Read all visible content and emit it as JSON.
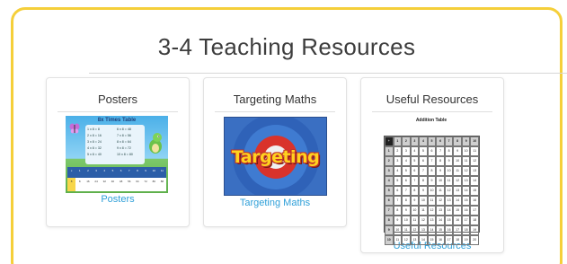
{
  "page": {
    "title": "3-4 Teaching Resources",
    "accent_color": "#f5cf3a",
    "link_color": "#2e9fd8"
  },
  "cards": [
    {
      "title": "Posters",
      "link": "Posters",
      "thumbnail_icon": "times-table-poster-icon"
    },
    {
      "title": "Targeting Maths",
      "link": "Targeting Maths",
      "thumbnail_icon": "targeting-logo-icon"
    },
    {
      "title": "Useful Resources",
      "link": "Useful Resources",
      "thumbnail_icon": "addition-table-icon"
    }
  ],
  "thumbnails": {
    "poster": {
      "title": "8x Times Table",
      "equations": [
        "1 x 8 = 8",
        "2 x 8 = 16",
        "3 x 8 = 24",
        "4 x 8 = 32",
        "5 x 8 = 40",
        "6 x 8 = 48",
        "7 x 8 = 56",
        "8 x 8 = 64",
        "9 x 8 = 72",
        "10 x 8 = 80"
      ]
    },
    "targeting": {
      "word": "Targeting"
    },
    "addition_table": {
      "title": "Addition Table"
    }
  }
}
